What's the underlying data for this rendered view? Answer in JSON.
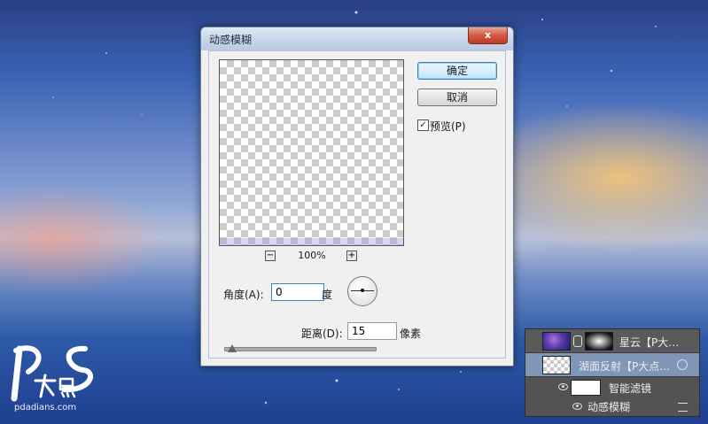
{
  "dialog": {
    "title": "动感模糊",
    "close_label": "x",
    "ok_label": "确定",
    "cancel_label": "取消",
    "preview_label": "预览(P)",
    "preview_checked": true,
    "zoom": {
      "minus": "−",
      "level": "100%",
      "plus": "+"
    },
    "angle_label": "角度(A):",
    "angle_value": "0",
    "angle_unit": "度",
    "distance_label": "距离(D):",
    "distance_value": "15",
    "distance_unit": "像素",
    "distance_slider_fraction": 0.05
  },
  "layers": [
    {
      "name": "星云【P大…",
      "thumbnail": "nebula",
      "has_mask": true,
      "selected": false
    },
    {
      "name": "湖面反射【P大点…",
      "thumbnail": "transparent",
      "smart_object": true,
      "selected": true
    },
    {
      "name": "智能滤镜",
      "thumbnail": "white-mask",
      "visible": true
    },
    {
      "name": "动感模糊",
      "visible": true,
      "has_filter_options": true
    }
  ],
  "watermark": {
    "logo_text": "PS大点",
    "url": "pdadians.com"
  },
  "colors": {
    "dialog_bg": "#f0f0f0",
    "selected_layer": "#7e96b8",
    "panel_bg": "#535353"
  }
}
